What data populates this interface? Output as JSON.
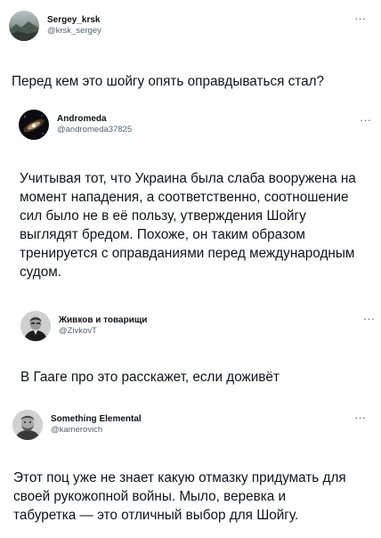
{
  "tweets": [
    {
      "name": "Sergey_krsk",
      "handle": "@krsk_sergey",
      "avatar_icon": "landscape-avatar",
      "more": "···",
      "text": "Перед кем это шойгу опять оправдываться стал?"
    },
    {
      "name": "Andromeda",
      "handle": "@andromeda37825",
      "avatar_icon": "galaxy-avatar",
      "more": "···",
      "text_lines": [
        "Учитывая тот, что Украина была слаба вооружена на",
        "момент нападения, а соответственно, соотношение",
        "сил было не в её пользу, утверждения Шойгу",
        "выглядят бредом. Похоже, он таким образом",
        "тренируется с оправданиями перед международным",
        "судом."
      ]
    },
    {
      "name": "Живков и товарищи",
      "handle": "@ZivkovT",
      "avatar_icon": "man-portrait-avatar",
      "more": "···",
      "text": "В Гааге про это расскажет, если доживёт"
    },
    {
      "name": "Something Elemental",
      "handle": "@kamerovich",
      "avatar_icon": "bearded-man-avatar",
      "more": "···",
      "text_lines": [
        "Этот поц уже не знает какую отмазку придумать для",
        "своей рукожопной войны. Мыло, веревка и",
        "табуретка — это отличный выбор для Шойгу."
      ]
    }
  ]
}
